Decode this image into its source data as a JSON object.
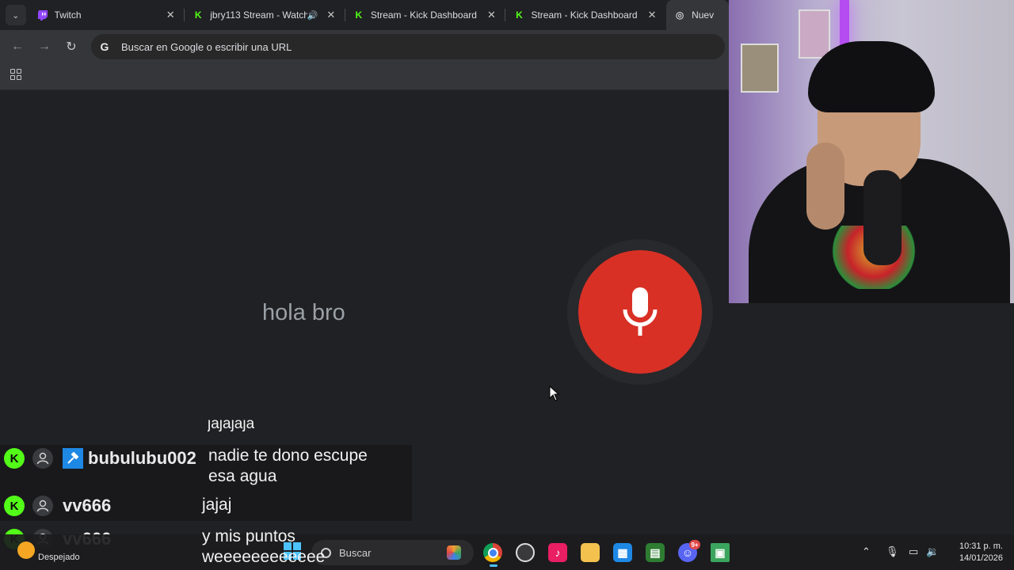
{
  "browser": {
    "tabs": [
      {
        "title": "Twitch",
        "icon": "twitch-icon",
        "has_audio": false
      },
      {
        "title": "jbry113 Stream - Watch",
        "icon": "kick-icon",
        "has_audio": true
      },
      {
        "title": "Stream - Kick Dashboard",
        "icon": "kick-icon",
        "has_audio": false
      },
      {
        "title": "Stream - Kick Dashboard",
        "icon": "kick-icon",
        "has_audio": false
      },
      {
        "title": "Nuev",
        "icon": "chrome-icon",
        "has_audio": false
      }
    ],
    "omnibox_placeholder": "Buscar en Google o escribir una URL"
  },
  "voice_search": {
    "transcript": "hola bro",
    "mic_color": "#d93025"
  },
  "chat": {
    "partial_line": "jajajaja",
    "messages": [
      {
        "username": "bubulubu002",
        "text_line1": "nadie te dono escupe",
        "text_line2": "esa agua"
      },
      {
        "username": "vv666",
        "text_line1": "jajaj",
        "text_line2": ""
      },
      {
        "username": "vv666",
        "text_line1": "y mis puntos",
        "text_line2": "weeeeeeeeeeee"
      }
    ],
    "kick_color": "#53fc18"
  },
  "taskbar": {
    "weather": "Despejado",
    "search_label": "Buscar",
    "time": "10:31 p. m.",
    "date": "14/01/2026",
    "discord_badge": "9+"
  }
}
